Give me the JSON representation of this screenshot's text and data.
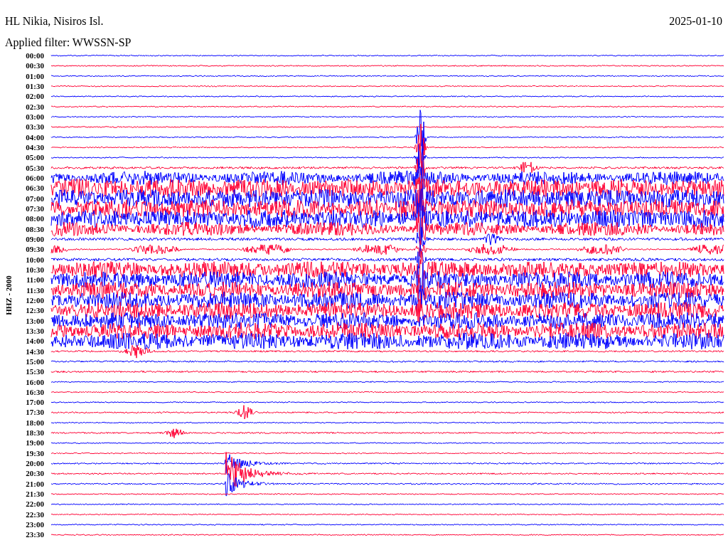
{
  "station": "HL Nikia, Nisiros Isl.",
  "date": "2025-01-10",
  "filter": "Applied filter: WWSSN-SP",
  "channel": "HHZ - 2000",
  "rows": [
    {
      "time": "00:00",
      "color": "#0000ff"
    },
    {
      "time": "00:30",
      "color": "#ff0033"
    },
    {
      "time": "01:00",
      "color": "#0000ff"
    },
    {
      "time": "01:30",
      "color": "#ff0033"
    },
    {
      "time": "02:00",
      "color": "#0000ff"
    },
    {
      "time": "02:30",
      "color": "#ff0033"
    },
    {
      "time": "03:00",
      "color": "#0000ff"
    },
    {
      "time": "03:30",
      "color": "#ff0033"
    },
    {
      "time": "04:00",
      "color": "#0000ff"
    },
    {
      "time": "04:30",
      "color": "#ff0033"
    },
    {
      "time": "05:00",
      "color": "#0000ff"
    },
    {
      "time": "05:30",
      "color": "#ff0033"
    },
    {
      "time": "06:00",
      "color": "#0000ff"
    },
    {
      "time": "06:30",
      "color": "#ff0033"
    },
    {
      "time": "07:00",
      "color": "#0000ff"
    },
    {
      "time": "07:30",
      "color": "#ff0033"
    },
    {
      "time": "08:00",
      "color": "#0000ff"
    },
    {
      "time": "08:30",
      "color": "#ff0033"
    },
    {
      "time": "09:00",
      "color": "#0000ff"
    },
    {
      "time": "09:30",
      "color": "#ff0033"
    },
    {
      "time": "10:00",
      "color": "#0000ff"
    },
    {
      "time": "10:30",
      "color": "#ff0033"
    },
    {
      "time": "11:00",
      "color": "#0000ff"
    },
    {
      "time": "11:30",
      "color": "#ff0033"
    },
    {
      "time": "12:00",
      "color": "#0000ff"
    },
    {
      "time": "12:30",
      "color": "#ff0033"
    },
    {
      "time": "13:00",
      "color": "#0000ff"
    },
    {
      "time": "13:30",
      "color": "#ff0033"
    },
    {
      "time": "14:00",
      "color": "#0000ff"
    },
    {
      "time": "14:30",
      "color": "#ff0033"
    },
    {
      "time": "15:00",
      "color": "#0000ff"
    },
    {
      "time": "15:30",
      "color": "#ff0033"
    },
    {
      "time": "16:00",
      "color": "#0000ff"
    },
    {
      "time": "16:30",
      "color": "#ff0033"
    },
    {
      "time": "17:00",
      "color": "#0000ff"
    },
    {
      "time": "17:30",
      "color": "#ff0033"
    },
    {
      "time": "18:00",
      "color": "#0000ff"
    },
    {
      "time": "18:30",
      "color": "#ff0033"
    },
    {
      "time": "19:00",
      "color": "#0000ff"
    },
    {
      "time": "19:30",
      "color": "#ff0033"
    },
    {
      "time": "20:00",
      "color": "#0000ff"
    },
    {
      "time": "20:30",
      "color": "#ff0033"
    },
    {
      "time": "21:00",
      "color": "#0000ff"
    },
    {
      "time": "21:30",
      "color": "#ff0033"
    },
    {
      "time": "22:00",
      "color": "#0000ff"
    },
    {
      "time": "22:30",
      "color": "#ff0033"
    },
    {
      "time": "23:00",
      "color": "#0000ff"
    },
    {
      "time": "23:30",
      "color": "#ff0033"
    }
  ]
}
